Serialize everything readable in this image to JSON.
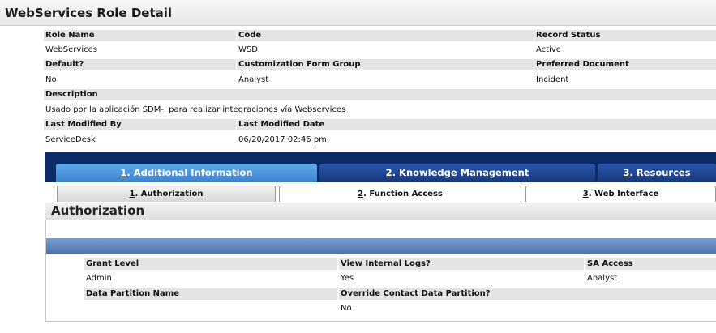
{
  "page": {
    "title": "WebServices Role Detail"
  },
  "fields": {
    "role_name": {
      "label": "Role Name",
      "value": "WebServices"
    },
    "code": {
      "label": "Code",
      "value": "WSD"
    },
    "record_status": {
      "label": "Record Status",
      "value": "Active"
    },
    "default": {
      "label": "Default?",
      "value": "No"
    },
    "customization_form_group": {
      "label": "Customization Form Group",
      "value": "Analyst"
    },
    "preferred_document": {
      "label": "Preferred Document",
      "value": "Incident"
    },
    "description": {
      "label": "Description",
      "value": "Usado por la aplicación SDM-I para realizar integraciones vía Webservices"
    },
    "last_modified_by": {
      "label": "Last Modified By",
      "value": "ServiceDesk"
    },
    "last_modified_date": {
      "label": "Last Modified Date",
      "value": "06/20/2017 02:46 pm"
    }
  },
  "tabs": [
    {
      "num": "1",
      "label": ". Additional Information",
      "active": true
    },
    {
      "num": "2",
      "label": ". Knowledge Management",
      "active": false
    },
    {
      "num": "3",
      "label": ". Resources",
      "active": false
    }
  ],
  "subtabs": [
    {
      "num": "1",
      "label": ". Authorization",
      "active": true
    },
    {
      "num": "2",
      "label": ". Function Access",
      "active": false
    },
    {
      "num": "3",
      "label": ". Web Interface",
      "active": false
    }
  ],
  "auth": {
    "title": "Authorization",
    "grant_level": {
      "label": "Grant Level",
      "value": "Admin"
    },
    "view_internal_logs": {
      "label": "View Internal Logs?",
      "value": "Yes"
    },
    "sa_access": {
      "label": "SA Access",
      "value": "Analyst"
    },
    "data_partition_name": {
      "label": "Data Partition Name",
      "value": ""
    },
    "override_contact_data_partition": {
      "label": "Override Contact Data Partition?",
      "value": "No"
    }
  },
  "colors": {
    "tab_active": "#3b83d3",
    "tab_inactive": "#17387f",
    "tab_strip": "#0c2a66",
    "label_bg": "#e4e4e4"
  }
}
